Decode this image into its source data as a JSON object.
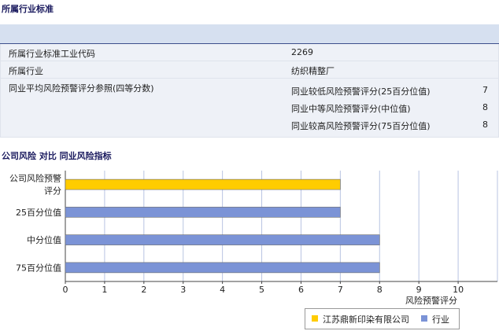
{
  "section1": {
    "title": "所属行业标准",
    "rows": [
      {
        "label": "所属行业标准工业代码",
        "value": "2269"
      },
      {
        "label": "所属行业",
        "value": "纺织精整厂"
      }
    ],
    "peer": {
      "label": "同业平均风险预警评分参照(四等分数)",
      "items": [
        {
          "label": "同业较低风险预警评分(25百分位值)",
          "value": "7"
        },
        {
          "label": "同业中等风险预警评分(中位值)",
          "value": "8"
        },
        {
          "label": "同业较高风险预警评分(75百分位值)",
          "value": "8"
        }
      ]
    }
  },
  "section2": {
    "title": "公司风险 对比 同业风险指标"
  },
  "chart_data": {
    "type": "bar",
    "orientation": "horizontal",
    "categories": [
      "公司风险预警评分",
      "25百分位值",
      "中分位值",
      "75百分位值"
    ],
    "category_label_lines": [
      [
        "公司风险预警",
        "评分"
      ],
      [
        "25百分位值"
      ],
      [
        "中分位值"
      ],
      [
        "75百分位值"
      ]
    ],
    "values": [
      7,
      7,
      8,
      8
    ],
    "bar_series": [
      0,
      1,
      1,
      1
    ],
    "series": [
      {
        "name": "江苏鼎新印染有限公司",
        "color": "#ffcc00"
      },
      {
        "name": "行业",
        "color": "#7b93d6"
      }
    ],
    "xlabel": "风险预警评分",
    "xlim": [
      0,
      11
    ],
    "xticks": [
      0,
      1,
      2,
      3,
      4,
      5,
      6,
      7,
      8,
      9,
      10
    ],
    "grid": true,
    "legend_position": "bottom-right"
  }
}
